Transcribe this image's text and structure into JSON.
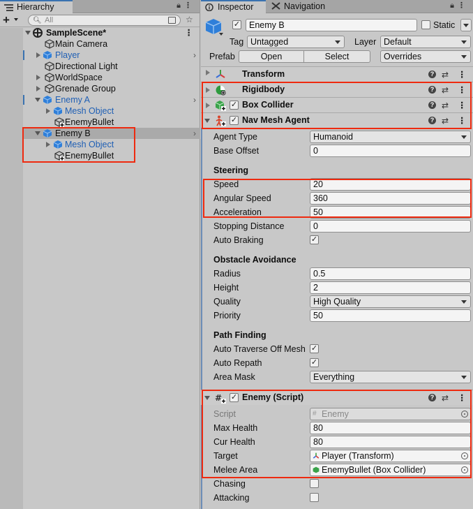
{
  "hierarchy": {
    "tab_title": "Hierarchy",
    "search_placeholder": "All",
    "scene_name": "SampleScene*",
    "items": [
      {
        "label": "Main Camera"
      },
      {
        "label": "Player"
      },
      {
        "label": "Directional Light"
      },
      {
        "label": "WorldSpace"
      },
      {
        "label": "Grenade Group"
      },
      {
        "label": "Enemy A"
      },
      {
        "label": "Mesh Object"
      },
      {
        "label": "EnemyBullet"
      },
      {
        "label": "Enemy B"
      },
      {
        "label": "Mesh Object"
      },
      {
        "label": "EnemyBullet"
      }
    ]
  },
  "inspector": {
    "tab_title": "Inspector",
    "nav_tab_title": "Navigation",
    "object_name": "Enemy B",
    "static_label": "Static",
    "tag_label": "Tag",
    "tag_value": "Untagged",
    "layer_label": "Layer",
    "layer_value": "Default",
    "prefab_label": "Prefab",
    "open_label": "Open",
    "select_label": "Select",
    "overrides_label": "Overrides",
    "components": {
      "transform": "Transform",
      "rigidbody": "Rigidbody",
      "box_collider": "Box Collider",
      "nav_mesh_agent": "Nav Mesh Agent",
      "enemy_script": "Enemy (Script)"
    },
    "nav": {
      "agent_type_label": "Agent Type",
      "agent_type_value": "Humanoid",
      "base_offset_label": "Base Offset",
      "base_offset_value": "0",
      "steering_header": "Steering",
      "speed_label": "Speed",
      "speed_value": "20",
      "angular_speed_label": "Angular Speed",
      "angular_speed_value": "360",
      "acceleration_label": "Acceleration",
      "acceleration_value": "50",
      "stopping_distance_label": "Stopping Distance",
      "stopping_distance_value": "0",
      "auto_braking_label": "Auto Braking",
      "obstacle_header": "Obstacle Avoidance",
      "radius_label": "Radius",
      "radius_value": "0.5",
      "height_label": "Height",
      "height_value": "2",
      "quality_label": "Quality",
      "quality_value": "High Quality",
      "priority_label": "Priority",
      "priority_value": "50",
      "pathfinding_header": "Path Finding",
      "auto_traverse_label": "Auto Traverse Off Mesh",
      "auto_repath_label": "Auto Repath",
      "area_mask_label": "Area Mask",
      "area_mask_value": "Everything"
    },
    "script": {
      "script_label": "Script",
      "script_value": "Enemy",
      "max_health_label": "Max Health",
      "max_health_value": "80",
      "cur_health_label": "Cur Health",
      "cur_health_value": "80",
      "target_label": "Target",
      "target_value": "Player (Transform)",
      "melee_label": "Melee Area",
      "melee_value": "EnemyBullet (Box Collider)",
      "chasing_label": "Chasing",
      "attacking_label": "Attacking"
    }
  },
  "colors": {
    "annotation": "#ee2a0f",
    "link_blue": "#1f5fb4",
    "accent": "#3a72b0"
  }
}
